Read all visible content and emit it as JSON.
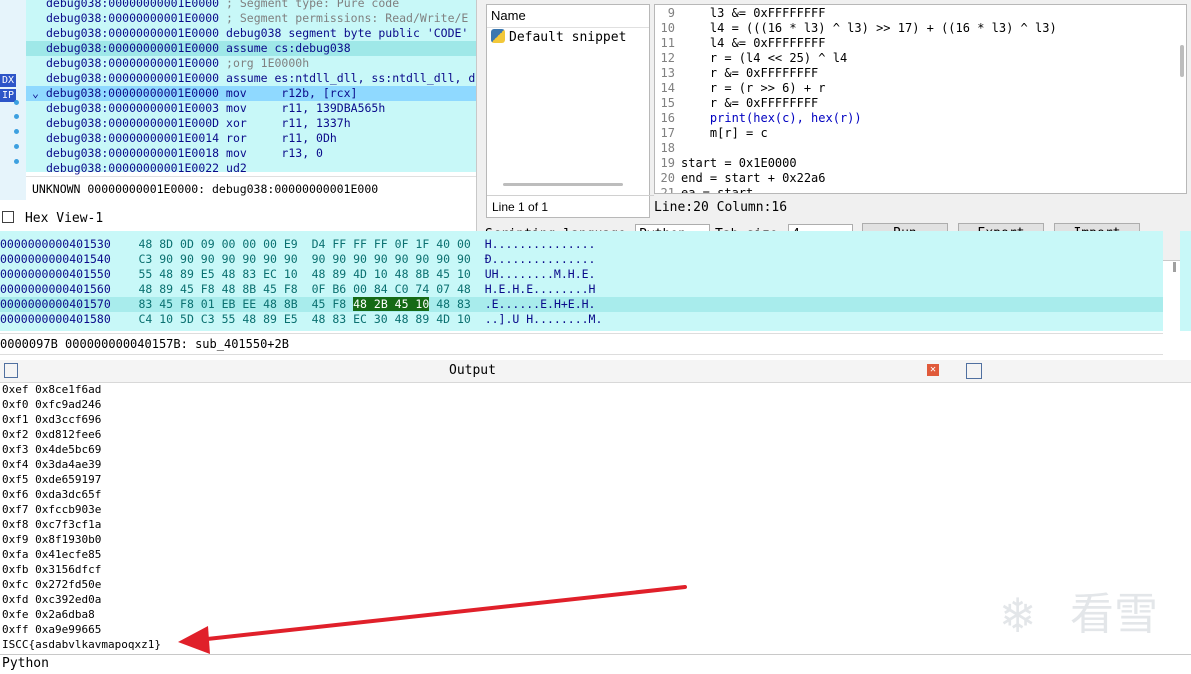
{
  "disasm": {
    "registers": [
      "DX",
      "IP"
    ],
    "lines": [
      {
        "addr": "debug038:00000000001E0000",
        "text": "; Segment type: Pure code",
        "kind": "comment"
      },
      {
        "addr": "debug038:00000000001E0000",
        "text": "; Segment permissions: Read/Write/E",
        "kind": "comment"
      },
      {
        "addr": "debug038:00000000001E0000",
        "text": "debug038 segment byte public 'CODE'",
        "kind": "code"
      },
      {
        "addr": "debug038:00000000001E0000",
        "text": "assume cs:debug038",
        "kind": "code"
      },
      {
        "addr": "debug038:00000000001E0000",
        "text": ";org 1E0000h",
        "kind": "comment"
      },
      {
        "addr": "debug038:00000000001E0000",
        "text": "assume es:ntdll_dll, ss:ntdll_dll, d",
        "kind": "code"
      },
      {
        "addr": "debug038:00000000001E0000",
        "text": "mov     r12b, [rcx]",
        "kind": "code"
      },
      {
        "addr": "debug038:00000000001E0003",
        "text": "mov     r11, 139DBA565h",
        "kind": "code"
      },
      {
        "addr": "debug038:00000000001E000D",
        "text": "xor     r11, 1337h",
        "kind": "code"
      },
      {
        "addr": "debug038:00000000001E0014",
        "text": "ror     r11, 0Dh",
        "kind": "code"
      },
      {
        "addr": "debug038:00000000001E0018",
        "text": "mov     r13, 0",
        "kind": "code"
      },
      {
        "addr": "debug038:00000000001E0022",
        "text": "ud2",
        "kind": "code"
      }
    ],
    "status": "UNKNOWN 00000000001E0000: debug038:00000000001E000"
  },
  "dialog": {
    "snippets_header": "Name",
    "snippet_item": "Default snippet",
    "snippet_count": "Line 1 of 1",
    "code_lines": [
      {
        "n": "9",
        "text": "    l3 &= 0xFFFFFFFF"
      },
      {
        "n": "10",
        "text": "    l4 = (((16 * l3) ^ l3) >> 17) + ((16 * l3) ^ l3)"
      },
      {
        "n": "11",
        "text": "    l4 &= 0xFFFFFFFF"
      },
      {
        "n": "12",
        "text": "    r = (l4 << 25) ^ l4"
      },
      {
        "n": "13",
        "text": "    r &= 0xFFFFFFFF"
      },
      {
        "n": "14",
        "text": "    r = (r >> 6) + r"
      },
      {
        "n": "15",
        "text": "    r &= 0xFFFFFFFF"
      },
      {
        "n": "16",
        "text": "    print(hex(c), hex(r))"
      },
      {
        "n": "17",
        "text": "    m[r] = c"
      },
      {
        "n": "18",
        "text": ""
      },
      {
        "n": "19",
        "text": "start = 0x1E0000"
      },
      {
        "n": "20",
        "text": "end = start + 0x22a6"
      },
      {
        "n": "21",
        "text": "ea = start"
      }
    ],
    "line_col": "Line:20 Column:16",
    "lang_label": "Scripting language",
    "lang_value": "Python",
    "tab_label": "Tab size",
    "tab_value": "4",
    "run_label": "Run",
    "export_label": "Export",
    "import_label": "Import"
  },
  "hex": {
    "title": "Hex View-1",
    "rows": [
      {
        "addr": "0000000000401530",
        "bytes": "48 8D 0D 09 00 00 00 E9  D4 FF FF FF 0F 1F 40 00",
        "ascii": "H..............."
      },
      {
        "addr": "0000000000401540",
        "bytes": "C3 90 90 90 90 90 90 90  90 90 90 90 90 90 90 90",
        "ascii": "Ð..............."
      },
      {
        "addr": "0000000000401550",
        "bytes": "55 48 89 E5 48 83 EC 10  48 89 4D 10 48 8B 45 10",
        "ascii": "UH........M.H.E."
      },
      {
        "addr": "0000000000401560",
        "bytes": "48 89 45 F8 48 8B 45 F8  0F B6 00 84 C0 74 07 48",
        "ascii": "H.E.H.E........H"
      },
      {
        "addr": "0000000000401570",
        "bytes_pre": "83 45 F8 01 EB EE 48 8B  45 F8 ",
        "bytes_sel": "48 2B 45 10",
        "bytes_post": " 48 83",
        "ascii": ".E......E.H+E.H."
      },
      {
        "addr": "0000000000401580",
        "bytes": "C4 10 5D C3 55 48 89 E5  48 83 EC 30 48 89 4D 10",
        "ascii": "..].U H........M."
      }
    ],
    "status": "0000097B 000000000040157B: sub_401550+2B"
  },
  "output": {
    "title": "Output",
    "lines": [
      "0xef 0x8ce1f6ad",
      "0xf0 0xfc9ad246",
      "0xf1 0xd3ccf696",
      "0xf2 0xd812fee6",
      "0xf3 0x4de5bc69",
      "0xf4 0x3da4ae39",
      "0xf5 0xde659197",
      "0xf6 0xda3dc65f",
      "0xf7 0xfccb903e",
      "0xf8 0xc7f3cf1a",
      "0xf9 0x8f1930b0",
      "0xfa 0x41ecfe85",
      "0xfb 0x3156dfcf",
      "0xfc 0x272fd50e",
      "0xfd 0xc392ed0a",
      "0xfe 0x2a6dba8",
      "0xff 0xa9e99665",
      "ISCC{asdabvlkavmapoqxz1}"
    ],
    "input_mode": "Python"
  },
  "watermark": "看雪",
  "colors": {
    "arrow": "#e0202a",
    "selection_blue": "#8fd9ff",
    "hex_bg": "#c8f8f8"
  }
}
